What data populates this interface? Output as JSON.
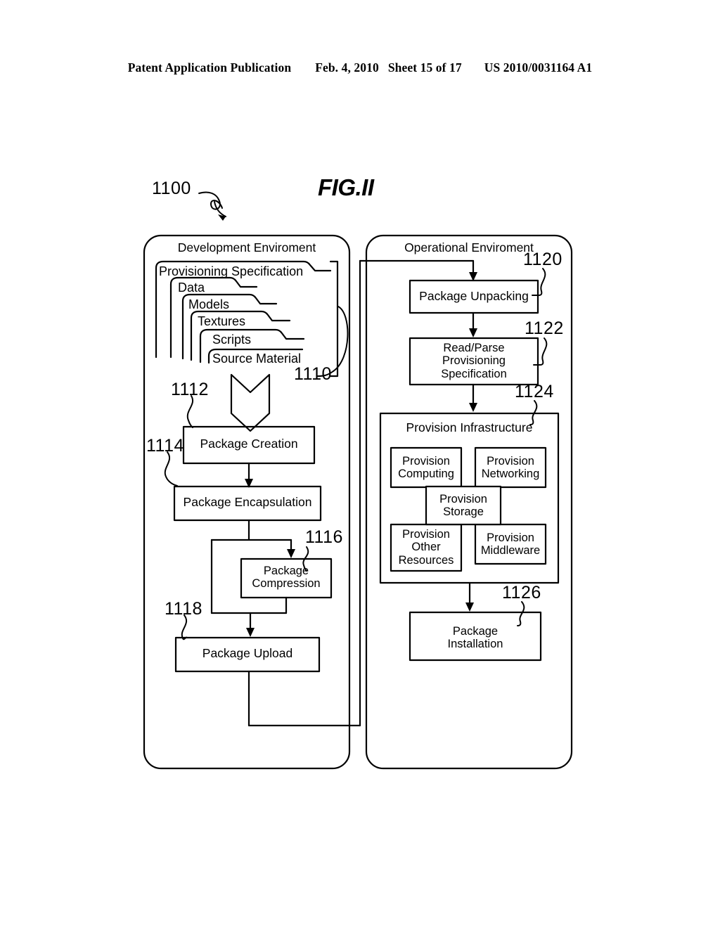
{
  "header": {
    "publication": "Patent Application Publication",
    "date": "Feb. 4, 2010",
    "sheet": "Sheet 15 of 17",
    "patent_number": "US 2010/0031164 A1"
  },
  "figure": {
    "title": "FIG.II",
    "figure_ref": "1100"
  },
  "development": {
    "panel_title": "Development Enviroment",
    "stack_ref": "1110",
    "tabs": [
      {
        "label": "Provisioning Specification"
      },
      {
        "label": "Data"
      },
      {
        "label": "Models"
      },
      {
        "label": "Textures"
      },
      {
        "label": "Scripts"
      },
      {
        "label": "Source Material"
      }
    ],
    "steps": [
      {
        "ref": "1112",
        "label": "Package Creation"
      },
      {
        "ref": "1114",
        "label": "Package Encapsulation"
      },
      {
        "ref": "1116",
        "label": "Package\nCompression"
      },
      {
        "ref": "1118",
        "label": "Package Upload"
      }
    ]
  },
  "operational": {
    "panel_title": "Operational Enviroment",
    "steps": [
      {
        "ref": "1120",
        "label": "Package Unpacking"
      },
      {
        "ref": "1122",
        "label": "Read/Parse\nProvisioning\nSpecification"
      },
      {
        "ref": "1126",
        "label": "Package\nInstallation"
      }
    ],
    "infrastructure": {
      "ref": "1124",
      "title": "Provision Infrastructure",
      "items": [
        {
          "label": "Provision\nComputing"
        },
        {
          "label": "Provision\nNetworking"
        },
        {
          "label": "Provision\nStorage"
        },
        {
          "label": "Provision\nOther\nResources"
        },
        {
          "label": "Provision\nMiddleware"
        }
      ]
    }
  },
  "colors": {
    "ink": "#000000",
    "paper": "#ffffff"
  }
}
